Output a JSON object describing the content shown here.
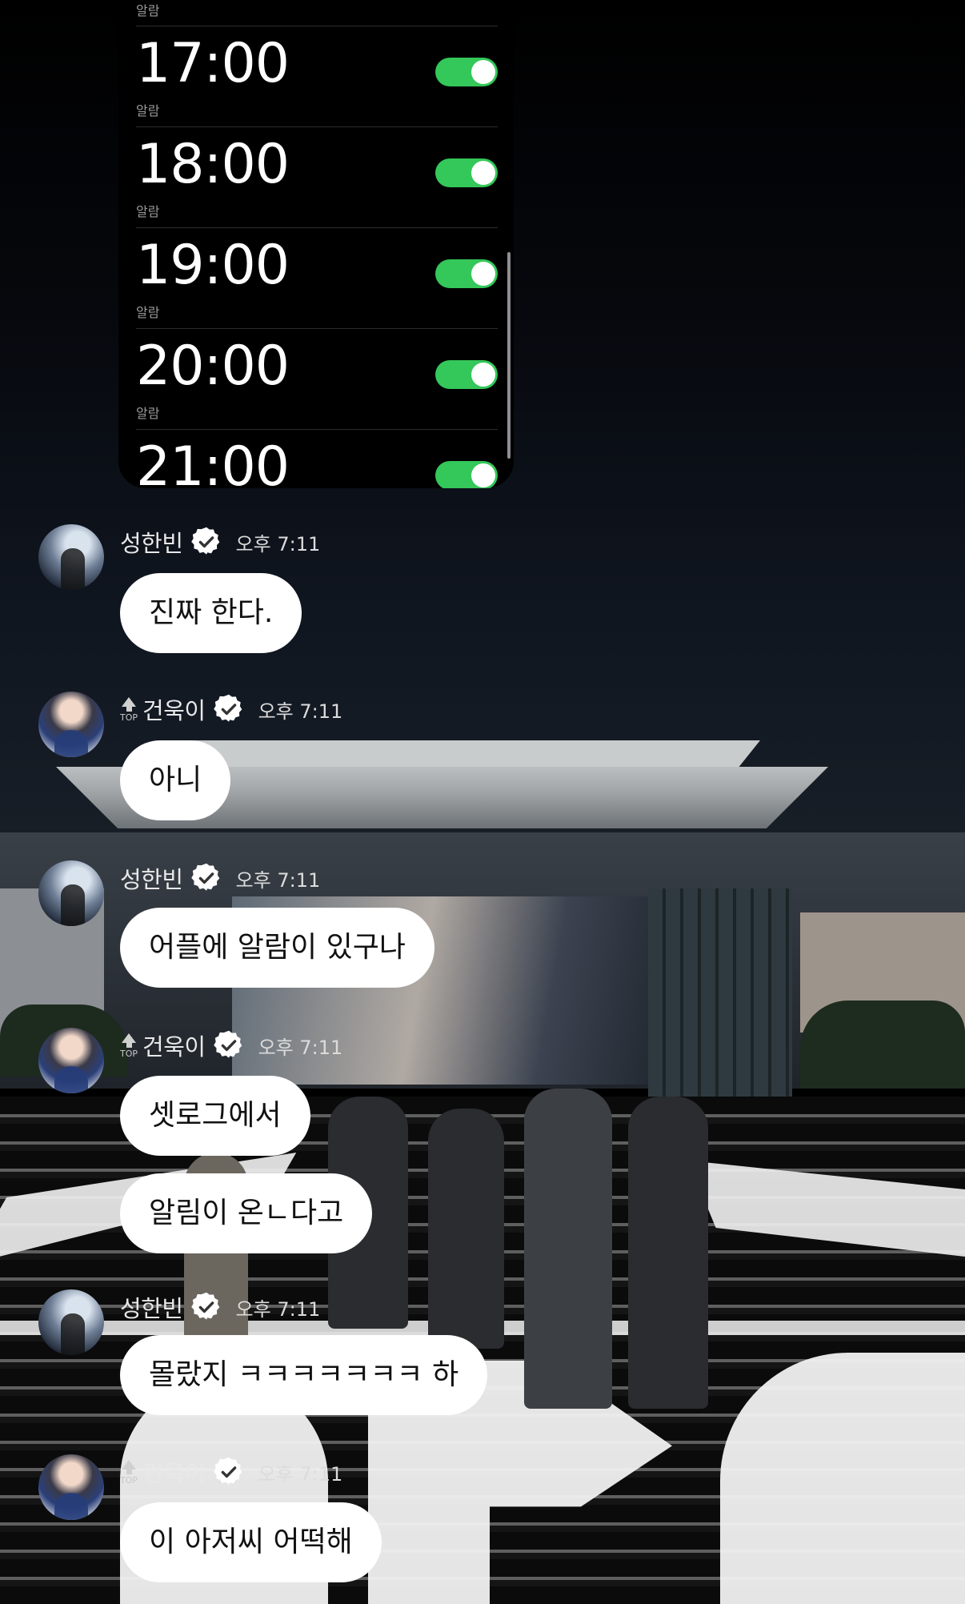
{
  "alarms": {
    "top_sub": "알람",
    "items": [
      {
        "time": "17:00",
        "label": "알람",
        "enabled": true
      },
      {
        "time": "18:00",
        "label": "알람",
        "enabled": true
      },
      {
        "time": "19:00",
        "label": "알람",
        "enabled": true
      },
      {
        "time": "20:00",
        "label": "알람",
        "enabled": true
      },
      {
        "time": "21:00",
        "label": "",
        "enabled": true
      }
    ]
  },
  "chat": {
    "messages": [
      {
        "sender": "성한빈",
        "time": "오후 7:11",
        "top": false,
        "bubbles": [
          "진짜 한다."
        ]
      },
      {
        "sender": "건욱이",
        "time": "오후 7:11",
        "top": true,
        "top_label": "TOP",
        "bubbles": [
          "아니"
        ]
      },
      {
        "sender": "성한빈",
        "time": "오후 7:11",
        "top": false,
        "bubbles": [
          "어플에 알람이 있구나"
        ]
      },
      {
        "sender": "건욱이",
        "time": "오후 7:11",
        "top": true,
        "top_label": "TOP",
        "bubbles": [
          "셋로그에서",
          "알림이 온ㄴ다고"
        ]
      },
      {
        "sender": "성한빈",
        "time": "오후 7:11",
        "top": false,
        "bubbles": [
          "몰랐지 ㅋㅋㅋㅋㅋㅋㅋ 하"
        ]
      },
      {
        "sender": "건욱이",
        "time": "오후 7:11",
        "top": true,
        "top_label": "TOP",
        "bubbles": [
          "이 아저씨 어떡해"
        ]
      }
    ]
  },
  "colors": {
    "toggle_on": "#34c759",
    "bubble": "#ffffff",
    "verified": "#ffffff"
  },
  "icons": {
    "verified": "verified-badge-icon",
    "top": "top-arrow-icon"
  }
}
